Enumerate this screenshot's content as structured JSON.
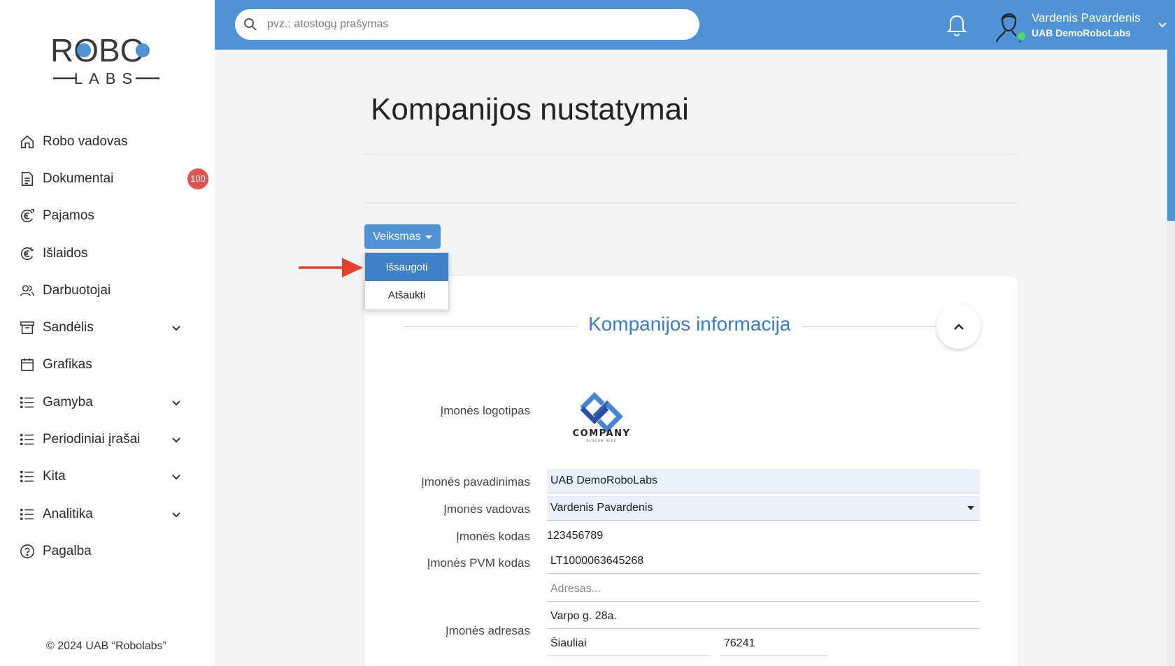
{
  "logo": {
    "top": "ROBO",
    "bottom": "LABS",
    "accent_color": "#4f93d6"
  },
  "sidebar": {
    "items": [
      {
        "label": "Robo vadovas",
        "icon": "home-icon",
        "expandable": false
      },
      {
        "label": "Dokumentai",
        "icon": "document-icon",
        "expandable": false,
        "badge": "100"
      },
      {
        "label": "Pajamos",
        "icon": "euro-in-icon",
        "expandable": false
      },
      {
        "label": "Išlaidos",
        "icon": "euro-out-icon",
        "expandable": false
      },
      {
        "label": "Darbuotojai",
        "icon": "users-icon",
        "expandable": false
      },
      {
        "label": "Sandėlis",
        "icon": "archive-icon",
        "expandable": true
      },
      {
        "label": "Grafikas",
        "icon": "calendar-icon",
        "expandable": false
      },
      {
        "label": "Gamyba",
        "icon": "list-icon",
        "expandable": true
      },
      {
        "label": "Periodiniai įrašai",
        "icon": "list-icon",
        "expandable": true
      },
      {
        "label": "Kita",
        "icon": "list-icon",
        "expandable": true
      },
      {
        "label": "Analitika",
        "icon": "list-icon",
        "expandable": true
      },
      {
        "label": "Pagalba",
        "icon": "help-icon",
        "expandable": false
      }
    ],
    "copyright": "© 2024 UAB “Robolabs”"
  },
  "header": {
    "search_placeholder": "pvz.: atostogų prašymas",
    "user_name": "Vardenis Pavardenis",
    "user_company": "UAB DemoRoboLabs",
    "bar_color": "#4f93d6"
  },
  "main": {
    "title": "Kompanijos nustatymai",
    "action_button": "Veiksmas",
    "action_menu": [
      {
        "label": "Išsaugoti",
        "active": true
      },
      {
        "label": "Atšaukti",
        "active": false
      }
    ],
    "section_title": "Kompanijos informacija",
    "logo_text": "COMPANY",
    "logo_slogan": "SLOGAN HERE",
    "fields": {
      "logo_label": "Įmonės logotipas",
      "name_label": "Įmonės pavadinimas",
      "name_value": "UAB DemoRoboLabs",
      "manager_label": "Įmonės vadovas",
      "manager_value": "Vardenis Pavardenis",
      "code_label": "Įmonės kodas",
      "code_value": "123456789",
      "vat_label": "Įmonės PVM kodas",
      "vat_value": "LT1000063645268",
      "address_placeholder": "Adresas...",
      "address_label": "Įmonės adresas",
      "street_value": "Varpo g. 28a.",
      "city_value": "Šiauliai",
      "zip_value": "76241"
    }
  }
}
